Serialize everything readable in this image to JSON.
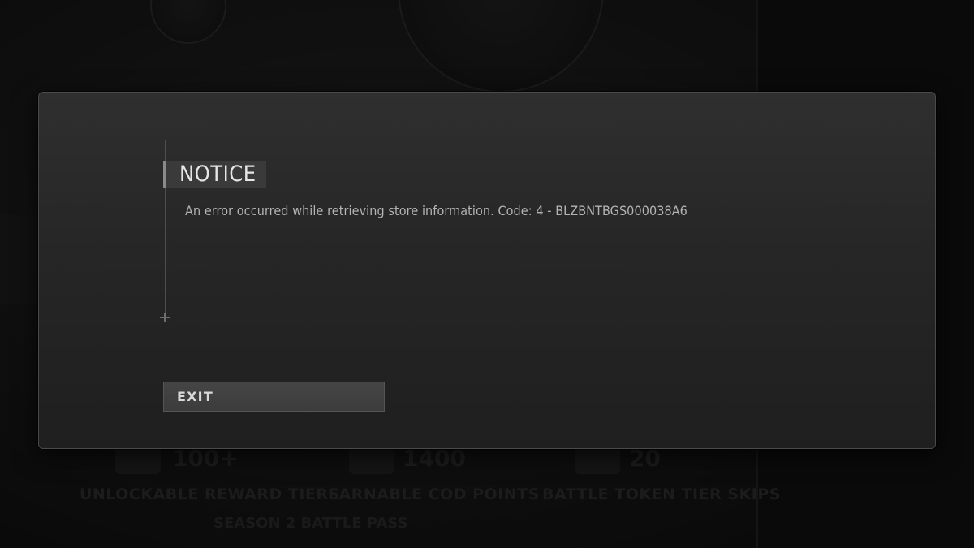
{
  "dialog": {
    "title": "NOTICE",
    "message": "An error occurred while retrieving store information. Code: 4 - BLZBNTBGS000038A6",
    "exit_label": "EXIT"
  },
  "background": {
    "stats": [
      {
        "number": "100+",
        "label": "UNLOCKABLE REWARD TIERS"
      },
      {
        "number": "1400",
        "label": "EARNABLE COD POINTS"
      },
      {
        "number": "20",
        "label": "BATTLE TOKEN TIER SKIPS"
      }
    ],
    "season_label": "SEASON 2 BATTLE PASS"
  },
  "colors": {
    "dialog_bg": "#262626",
    "title_tag_bg": "#3a3a3a",
    "exit_button_bg": "#404040",
    "text_primary": "#e6e6e6",
    "text_secondary": "#b4b4b4"
  }
}
